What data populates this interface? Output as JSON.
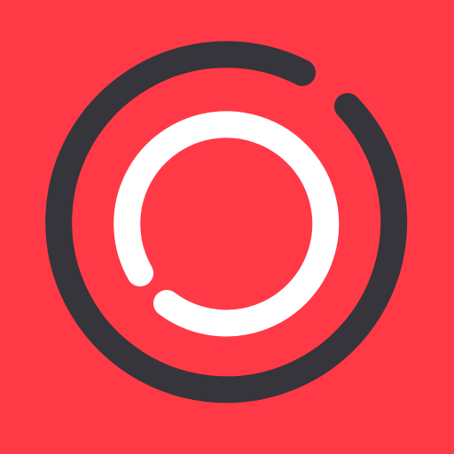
{
  "icon": {
    "name": "app-logo-icon",
    "colors": {
      "background": "#FF3A46",
      "outer_ring": "#35353B",
      "inner_ring": "#FFFFFF"
    }
  }
}
